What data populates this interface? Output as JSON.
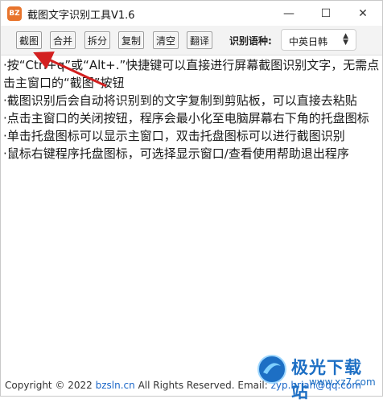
{
  "window": {
    "title": "截图文字识别工具V1.6",
    "app_icon_text": "BZ",
    "minimize_glyph": "—",
    "maximize_glyph": "☐",
    "close_glyph": "✕"
  },
  "toolbar": {
    "buttons": [
      "截图",
      "合并",
      "拆分",
      "复制",
      "清空",
      "翻译"
    ],
    "language_label": "识别语种:",
    "language_selected": "中英日韩"
  },
  "content": {
    "lines": [
      "·按“Ctrl+q”或“Alt+.”快捷键可以直接进行屏幕截图识别文字，无需点击主窗口的“截图”按钮",
      "·截图识别后会自动将识别到的文字复制到剪贴板，可以直接去粘贴",
      "·点击主窗口的关闭按钮，程序会最小化至电脑屏幕右下角的托盘图标",
      "·单击托盘图标可以显示主窗口，双击托盘图标可以进行截图识别",
      "·鼠标右键程序托盘图标，可选择显示窗口/查看使用帮助退出程序"
    ]
  },
  "footer": {
    "copyright": "Copyright © 2022 ",
    "site": "bzsln.cn",
    "rights": "  All Rights Reserved.  Email: ",
    "email": "zyp.brian@qq.com"
  },
  "watermark": {
    "title": "极光下载站",
    "domain": "www.xz7.com"
  },
  "colors": {
    "accent": "#1d6fc4",
    "annotation": "#d32020",
    "app_icon": "#e8742c"
  }
}
